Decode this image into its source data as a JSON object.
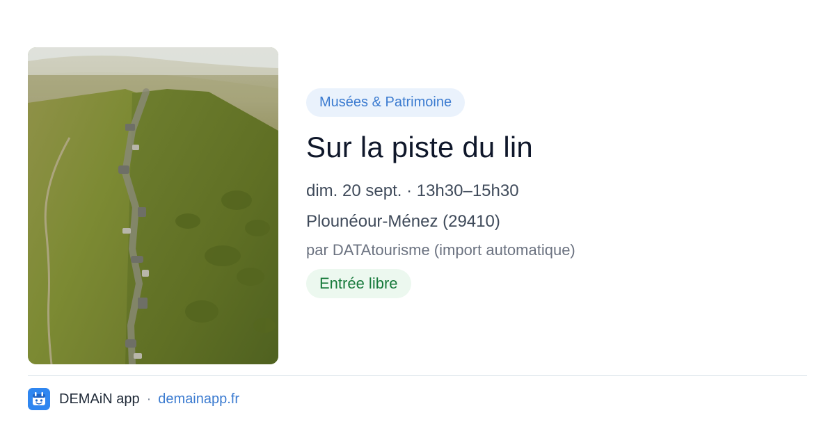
{
  "event": {
    "category": "Musées & Patrimoine",
    "title": "Sur la piste du lin",
    "datetime": "dim. 20 sept. · 13h30–15h30",
    "location": "Plounéour-Ménez (29410)",
    "byline": "par DATAtourisme (import automatique)",
    "price": "Entrée libre"
  },
  "footer": {
    "app_name": "DEMAiN app",
    "separator": "·",
    "url": "demainapp.fr"
  },
  "colors": {
    "category_text": "#3b7bd0",
    "category_bg": "#eaf2fc",
    "price_text": "#177a3b",
    "price_bg": "#ecf8ef",
    "link": "#3b7bd0",
    "app_icon_bg": "#2f86f0"
  },
  "icons": {
    "app_icon": "demain-app-icon"
  }
}
